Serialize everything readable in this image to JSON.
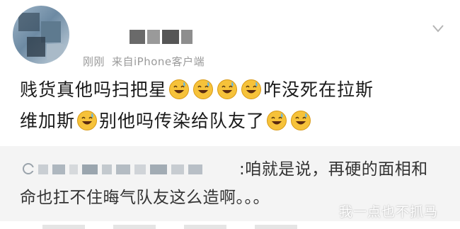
{
  "post": {
    "meta_time": "刚刚",
    "meta_source": "来自iPhone客户端",
    "line1_a": "贱货真他吗扫把星",
    "line1_b": "咋没死在拉斯",
    "line2_a": "维加斯",
    "line2_b": "别他吗传染给队友了",
    "emoji_name": "sweat-smile-emoji"
  },
  "quote": {
    "text": ":咱就是说，再硬的面相和命也扛不住晦气队友这么造啊。。。"
  },
  "watermark": "我一点也不抓马",
  "colors": {
    "emoji_face": "#f6c23a",
    "meta_text": "#9a9a9a",
    "quote_bg": "#f4f4f4"
  }
}
